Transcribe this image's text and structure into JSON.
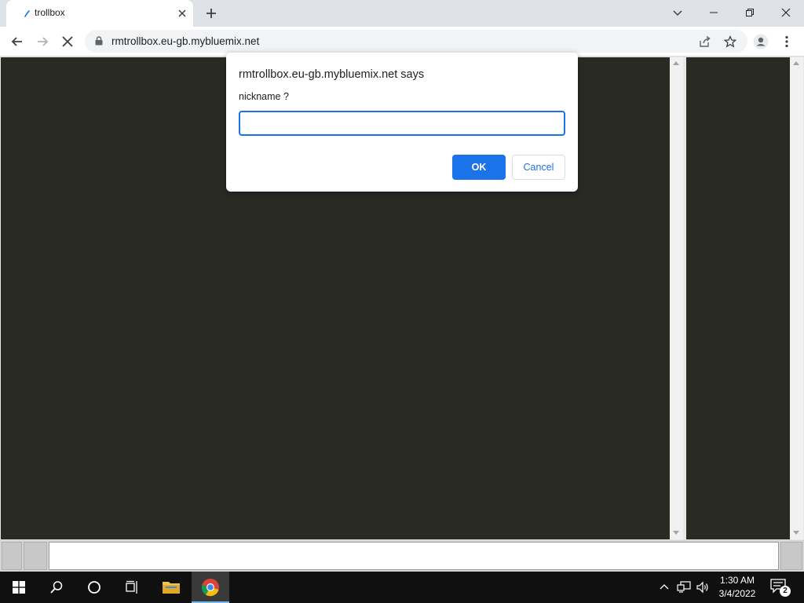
{
  "browser": {
    "tab": {
      "title": "trollbox"
    },
    "url": "rmtrollbox.eu-gb.mybluemix.net"
  },
  "dialog": {
    "title": "rmtrollbox.eu-gb.mybluemix.net says",
    "message": "nickname ?",
    "input_value": "",
    "ok_label": "OK",
    "cancel_label": "Cancel"
  },
  "taskbar": {
    "time": "1:30 AM",
    "date": "3/4/2022",
    "notification_count": "2"
  },
  "colors": {
    "accent": "#1a73e8",
    "page_background": "#2a2a25",
    "taskbar": "#101010"
  }
}
